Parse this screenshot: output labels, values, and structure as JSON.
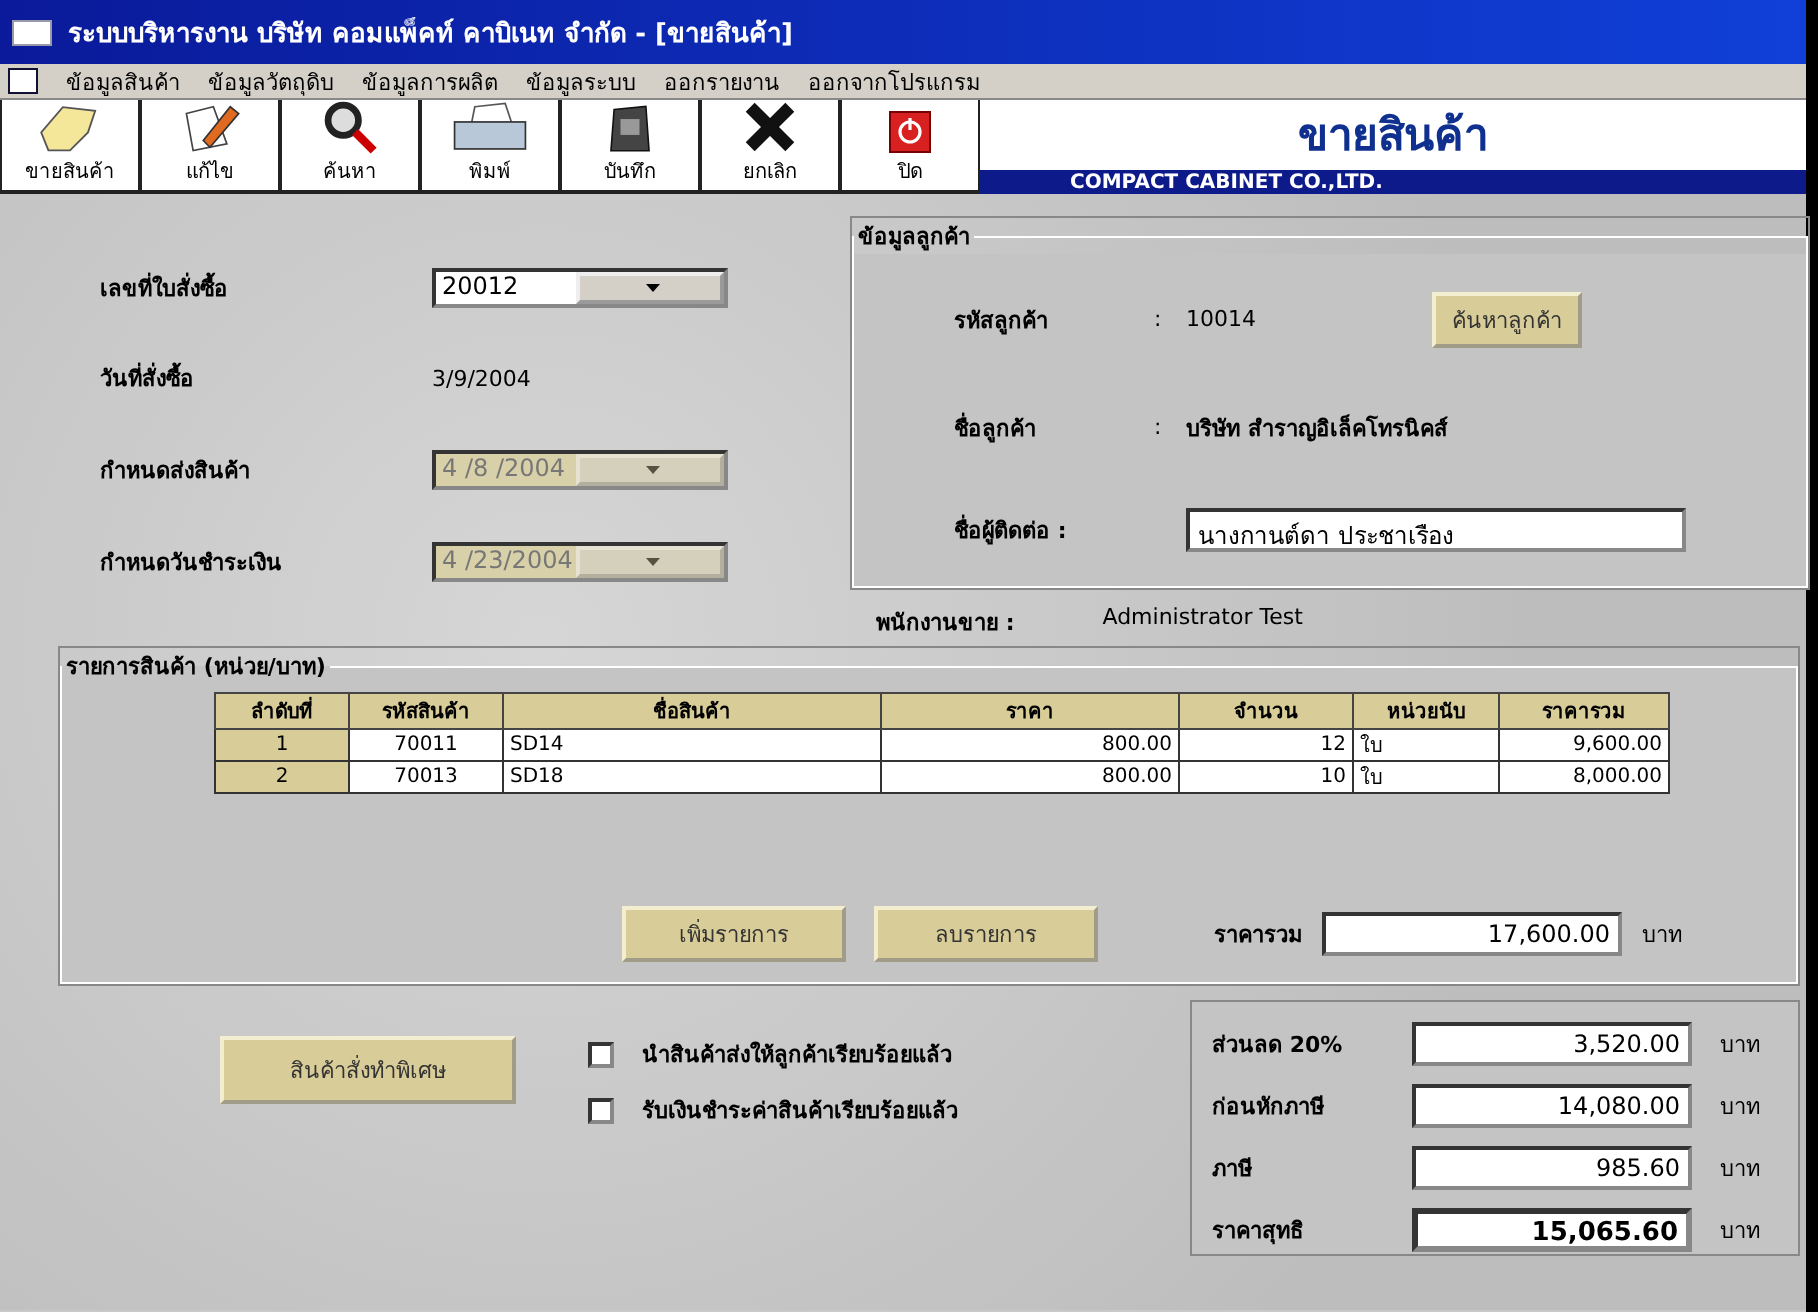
{
  "window": {
    "title": "ระบบบริหารงาน บริษัท คอมแพ็คท์ คาบิเนท จำกัด - [ขายสินค้า]"
  },
  "menu": [
    "ข้อมูลสินค้า",
    "ข้อมูลวัตถุดิบ",
    "ข้อมูลการผลิต",
    "ข้อมูลระบบ",
    "ออกรายงาน",
    "ออกจากโปรแกรม"
  ],
  "toolbar": [
    "ขายสินค้า",
    "แก้ไข",
    "ค้นหา",
    "พิมพ์",
    "บันทึก",
    "ยกเลิก",
    "ปิด"
  ],
  "banner": {
    "title": "ขายสินค้า",
    "company": "COMPACT CABINET CO.,LTD."
  },
  "order": [
    {
      "label": "เลขที่ใบสั่งซื้อ",
      "value": "20012",
      "kind": "dropdown",
      "disabled": false
    },
    {
      "label": "วันที่สั่งซื้อ",
      "value": "3/9/2004",
      "kind": "text"
    },
    {
      "label": "กำหนดส่งสินค้า",
      "value": "4 /8 /2004",
      "kind": "dropdown",
      "disabled": true
    },
    {
      "label": "กำหนดวันชำระเงิน",
      "value": "4 /23/2004",
      "kind": "dropdown",
      "disabled": true
    }
  ],
  "customer": {
    "title": "ข้อมูลลูกค้า",
    "code_label": "รหัสลูกค้า",
    "code_sep": ":",
    "code": "10014",
    "search_button": "ค้นหาลูกค้า",
    "name_label": "ชื่อลูกค้า",
    "name_sep": ":",
    "name": "บริษัท สำราญอิเล็คโทรนิคส์",
    "contact_label": "ชื่อผู้ติดต่อ :",
    "contact": "นางกานต์ดา ประชาเรือง"
  },
  "salesperson": {
    "label": "พนักงานขาย :",
    "value": "Administrator   Test"
  },
  "items": {
    "title": "รายการสินค้า (หน่วย/บาท)",
    "columns": [
      "ลำดับที่",
      "รหัสสินค้า",
      "ชื่อสินค้า",
      "ราคา",
      "จำนวน",
      "หน่วยนับ",
      "ราคารวม"
    ],
    "rows": [
      [
        "1",
        "70011",
        "SD14",
        "800.00",
        "12",
        "ใบ",
        "9,600.00"
      ],
      [
        "2",
        "70013",
        "SD18",
        "800.00",
        "10",
        "ใบ",
        "8,000.00"
      ]
    ],
    "add_button": "เพิ่มรายการ",
    "delete_button": "ลบรายการ",
    "total_label": "ราคารวม",
    "total": "17,600.00",
    "currency": "บาท"
  },
  "special_button": "สินค้าสั่งทำพิเศษ",
  "checks": [
    {
      "label": "นำสินค้าส่งให้ลูกค้าเรียบร้อยแล้ว",
      "checked": false
    },
    {
      "label": "รับเงินชำระค่าสินค้าเรียบร้อยแล้ว",
      "checked": false
    }
  ],
  "summary": [
    {
      "label": "ส่วนลด  20%",
      "value": "3,520.00",
      "unit": "บาท",
      "bold": false
    },
    {
      "label": "ก่อนหักภาษี",
      "value": "14,080.00",
      "unit": "บาท",
      "bold": false
    },
    {
      "label": "ภาษี",
      "value": "985.60",
      "unit": "บาท",
      "bold": false
    },
    {
      "label": "ราคาสุทธิ",
      "value": "15,065.60",
      "unit": "บาท",
      "bold": true
    }
  ]
}
